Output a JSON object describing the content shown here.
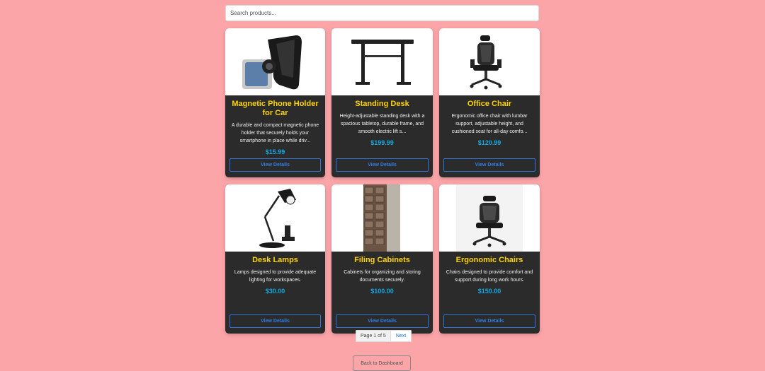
{
  "search": {
    "placeholder": "Search products..."
  },
  "products": [
    {
      "name": "Magnetic Phone Holder for Car",
      "description": "A durable and compact magnetic phone holder that securely holds your smartphone in place while driv...",
      "price": "$15.99",
      "button": "View Details"
    },
    {
      "name": "Standing Desk",
      "description": "Height-adjustable standing desk with a spacious tabletop, durable frame, and smooth electric lift s...",
      "price": "$199.99",
      "button": "View Details"
    },
    {
      "name": "Office Chair",
      "description": "Ergonomic office chair with lumbar support, adjustable height, and cushioned seat for all-day comfo...",
      "price": "$120.99",
      "button": "View Details"
    },
    {
      "name": "Desk Lamps",
      "description": "Lamps designed to provide adequate lighting for workspaces.",
      "price": "$30.00",
      "button": "View Details"
    },
    {
      "name": "Filing Cabinets",
      "description": "Cabinets for organizing and storing documents securely.",
      "price": "$100.00",
      "button": "View Details"
    },
    {
      "name": "Ergonomic Chairs",
      "description": "Chairs designed to provide comfort and support during long work hours.",
      "price": "$150.00",
      "button": "View Details"
    }
  ],
  "pagination": {
    "info": "Page 1 of 5",
    "next": "Next"
  },
  "back_button": "Back to Dashboard",
  "colors": {
    "background": "#fca5a9",
    "card": "#2b2b2b",
    "title": "#ffd400",
    "price": "#12a8e0",
    "button": "#2f74d8"
  }
}
